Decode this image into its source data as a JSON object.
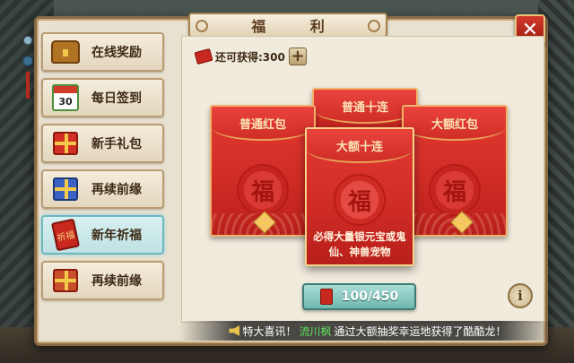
{
  "window": {
    "title": "福 利",
    "close_label": "✕"
  },
  "sidebar": {
    "items": [
      {
        "label": "在线奖励",
        "icon": "treasure-chest-icon",
        "active": false
      },
      {
        "label": "每日签到",
        "icon": "calendar-icon",
        "calendar_day": "30",
        "active": false
      },
      {
        "label": "新手礼包",
        "icon": "gift-box-icon",
        "active": false
      },
      {
        "label": "再续前缘",
        "icon": "gift-basket-icon",
        "active": false
      },
      {
        "label": "新年祈福",
        "icon": "red-envelope-icon",
        "envelope_char": "祈福",
        "active": true
      },
      {
        "label": "再续前缘",
        "icon": "gift-box-icon",
        "active": false
      }
    ]
  },
  "quota": {
    "label": "还可获得:300",
    "plus_label": "+"
  },
  "envelopes": {
    "left": {
      "title": "普通红包",
      "seal": "福"
    },
    "back": {
      "title": "普通十连"
    },
    "right": {
      "title": "大额红包",
      "seal": "福"
    },
    "front": {
      "title": "大额十连",
      "seal": "福",
      "description": "必得大量银元宝或鬼仙、神兽宠物"
    }
  },
  "open_button": {
    "count": "100/450"
  },
  "info_button": {
    "label": "i"
  },
  "marquee": {
    "prefix": "特大喜讯！",
    "player": "流川枫",
    "suffix": "通过大额抽奖幸运地获得了酷酷龙！"
  },
  "colors": {
    "envelope_red": "#cf2b25",
    "gold_trim": "#f1b36b",
    "active_tab": "#bfe1e3",
    "player_name": "#5ee25e"
  }
}
